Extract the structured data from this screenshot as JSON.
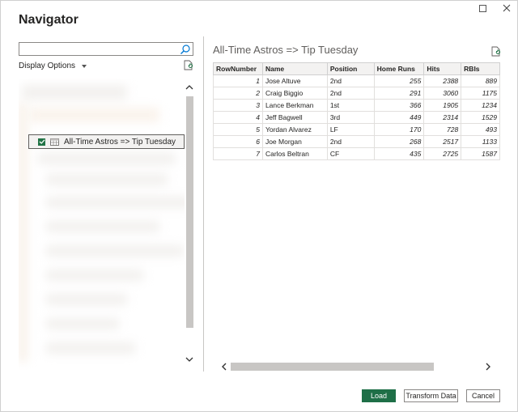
{
  "window": {
    "title": "Navigator"
  },
  "left_pane": {
    "search": {
      "value": "",
      "placeholder": ""
    },
    "display_options_label": "Display Options",
    "tree_item": {
      "label": "All-Time Astros => Tip Tuesday",
      "checked": true
    }
  },
  "preview": {
    "title": "All-Time Astros => Tip Tuesday",
    "columns": [
      "RowNumber",
      "Name",
      "Position",
      "Home Runs",
      "Hits",
      "RBIs"
    ],
    "rows": [
      [
        "1",
        "Jose Altuve",
        "2nd",
        "255",
        "2388",
        "889"
      ],
      [
        "2",
        "Craig Biggio",
        "2nd",
        "291",
        "3060",
        "1175"
      ],
      [
        "3",
        "Lance Berkman",
        "1st",
        "366",
        "1905",
        "1234"
      ],
      [
        "4",
        "Jeff Bagwell",
        "3rd",
        "449",
        "2314",
        "1529"
      ],
      [
        "5",
        "Yordan Alvarez",
        "LF",
        "170",
        "728",
        "493"
      ],
      [
        "6",
        "Joe Morgan",
        "2nd",
        "268",
        "2517",
        "1133"
      ],
      [
        "7",
        "Carlos Beltran",
        "CF",
        "435",
        "2725",
        "1587"
      ]
    ]
  },
  "footer": {
    "load_label": "Load",
    "transform_label": "Transform Data",
    "cancel_label": "Cancel"
  },
  "colors": {
    "accent": "#1e6f47",
    "checkbox": "#217346"
  }
}
